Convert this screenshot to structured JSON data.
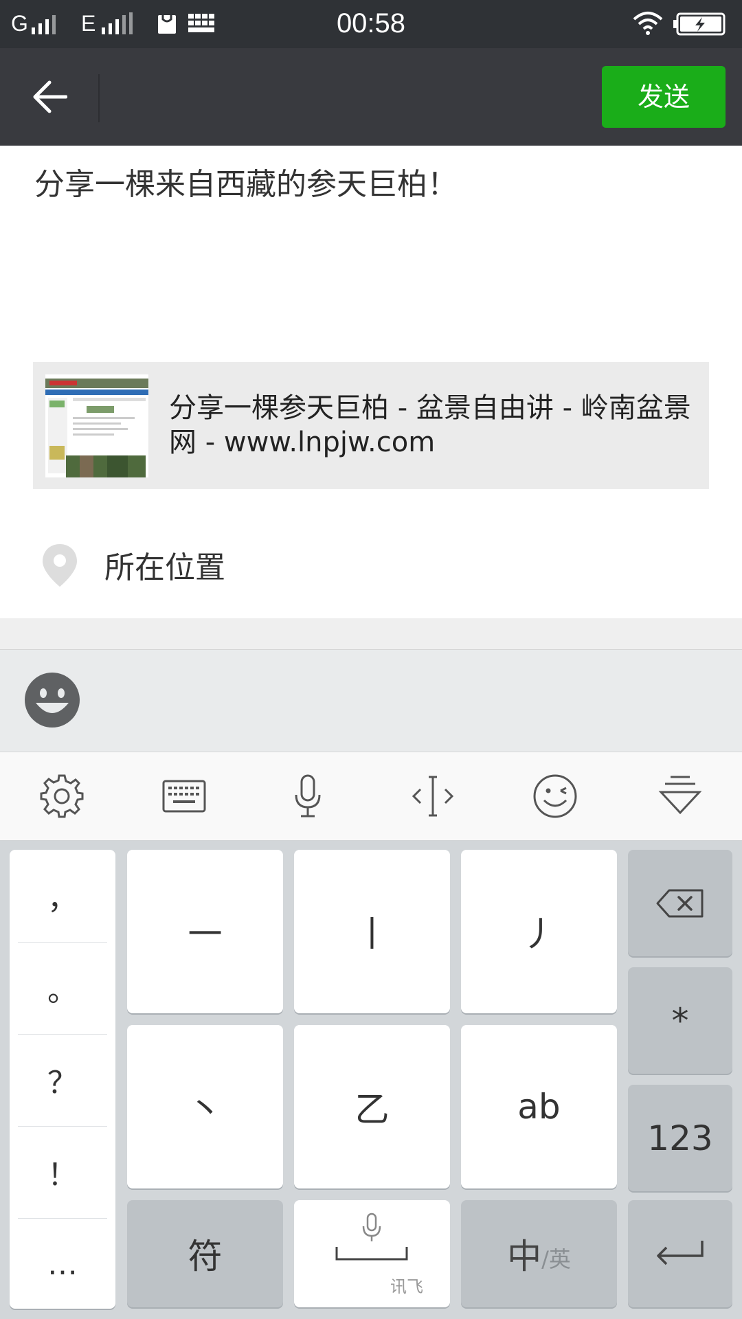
{
  "status_bar": {
    "sim1": "G",
    "sim2": "E",
    "time": "00:58"
  },
  "header": {
    "send_label": "发送"
  },
  "compose": {
    "text": "分享一棵来自西藏的参天巨柏！",
    "link_card": {
      "title": "分享一棵参天巨柏 - 盆景自由讲 - 岭南盆景网 - www.lnpjw.com"
    },
    "location_label": "所在位置"
  },
  "keyboard": {
    "toolbar_icons": [
      "gear-icon",
      "keyboard-icon",
      "microphone-icon",
      "cursor-move-icon",
      "smile-icon",
      "collapse-keyboard-icon"
    ],
    "punctuation": [
      "，",
      "。",
      "？",
      "！",
      "…"
    ],
    "stroke_keys": [
      "一",
      "丨",
      "丿",
      "丶",
      "乙",
      "ab"
    ],
    "right_keys": {
      "star": "*",
      "numbers": "123"
    },
    "bottom": {
      "symbols": "符",
      "space_brand": "讯飞",
      "lang_main": "中",
      "lang_alt": "/英"
    }
  },
  "colors": {
    "accent": "#1aad19",
    "titlebar": "#393a3f",
    "statusbar": "#2f3236"
  }
}
